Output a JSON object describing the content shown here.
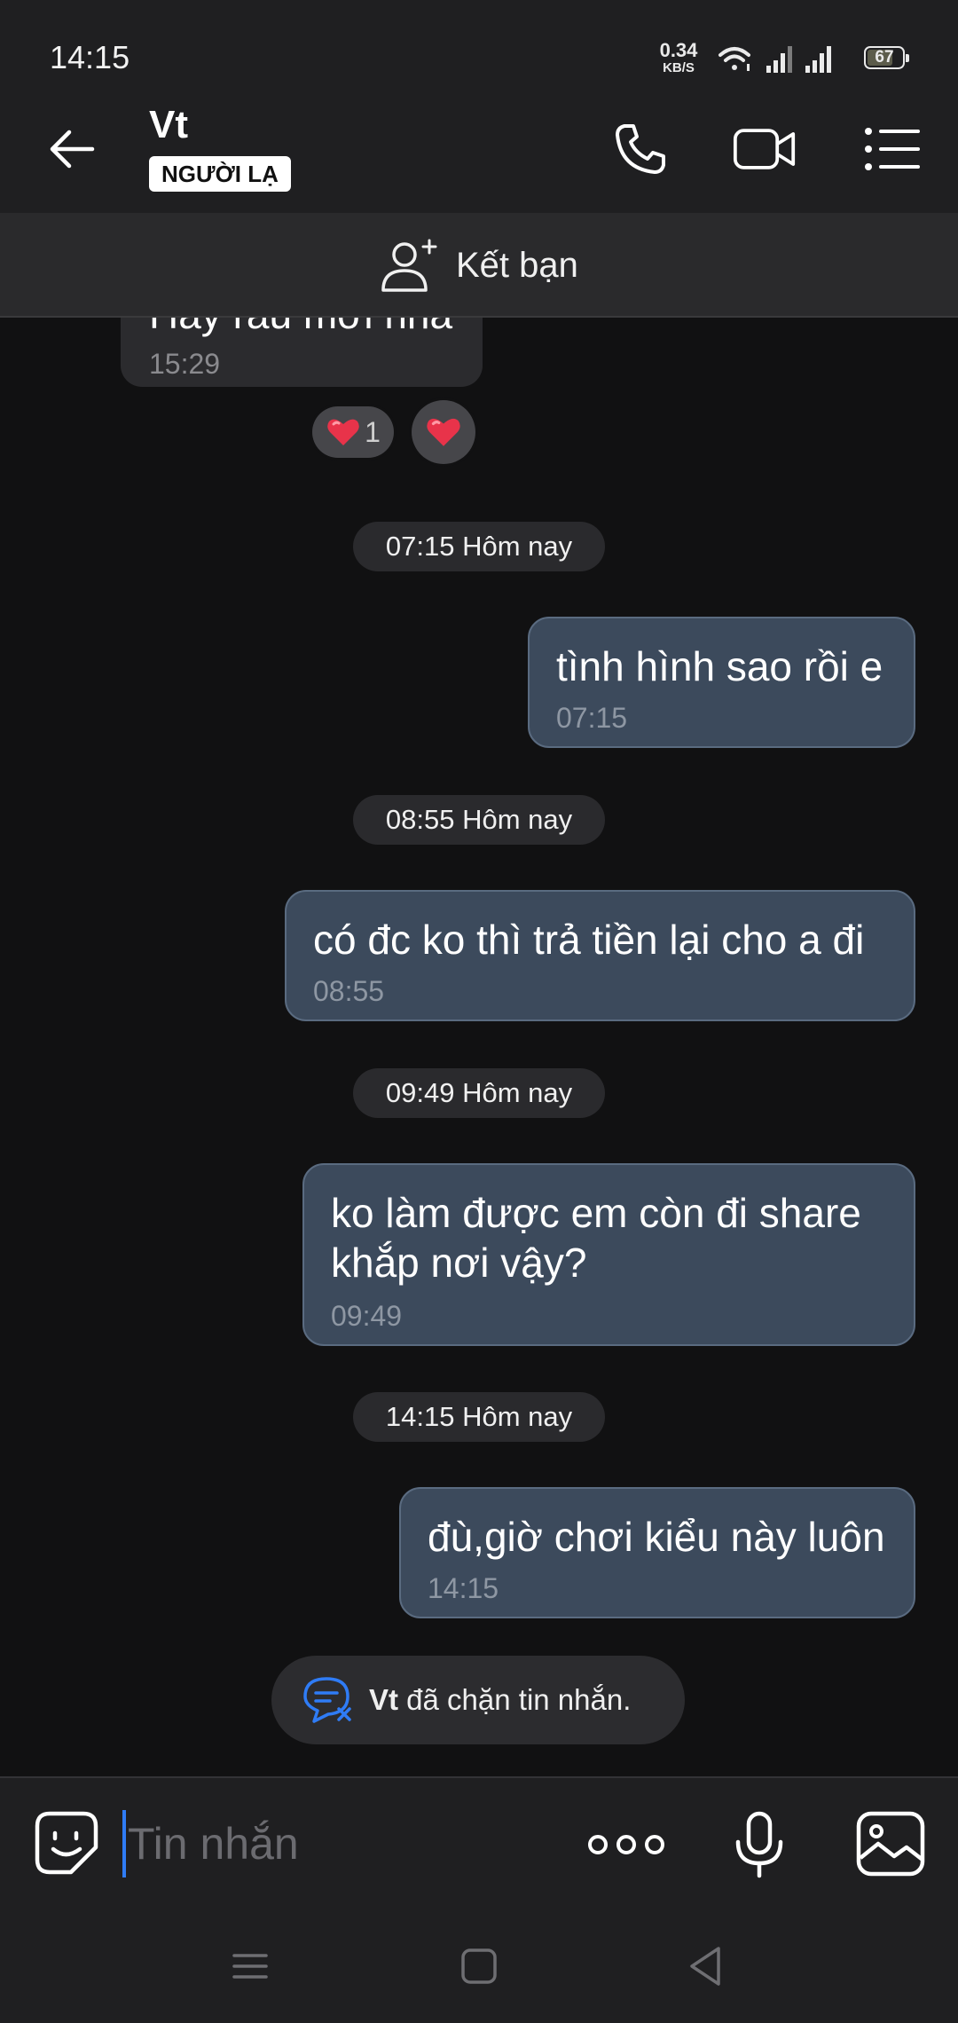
{
  "status_bar": {
    "time": "14:15",
    "net_speed_value": "0.34",
    "net_speed_unit": "KB/S",
    "battery": "67"
  },
  "header": {
    "contact_name": "Vt",
    "badge": "NGƯỜI LẠ",
    "icons": [
      "back-arrow-icon",
      "phone-icon",
      "video-call-icon",
      "menu-list-icon"
    ]
  },
  "friend_bar": {
    "label": "Kết bạn",
    "icon": "add-person-icon"
  },
  "messages": [
    {
      "direction": "in",
      "text": "Hay rau mới nha",
      "time": "15:29",
      "reactions": [
        {
          "emoji": "❤️",
          "count": "1"
        },
        {
          "emoji": "❤️"
        }
      ]
    },
    {
      "direction": "out",
      "text": "tình hình sao rồi e",
      "time": "07:15"
    },
    {
      "direction": "out",
      "text": "có đc ko thì trả tiền lại cho a đi",
      "time": "08:55"
    },
    {
      "direction": "out",
      "text": "ko làm được em còn đi share khắp nơi vậy?",
      "time": "09:49"
    },
    {
      "direction": "out",
      "text": "đù,giờ chơi kiểu này luôn",
      "time": "14:15"
    }
  ],
  "date_dividers": [
    "07:15 Hôm nay",
    "08:55 Hôm nay",
    "09:49 Hôm nay",
    "14:15 Hôm nay"
  ],
  "block_notice": {
    "name": "Vt",
    "text": " đã chặn tin nhắn."
  },
  "composer": {
    "placeholder": "Tin nhắn",
    "value": ""
  },
  "colors": {
    "outgoing_bubble": "#3c4a5c",
    "accent": "#2f7cf6",
    "heart": "#e8334a"
  }
}
